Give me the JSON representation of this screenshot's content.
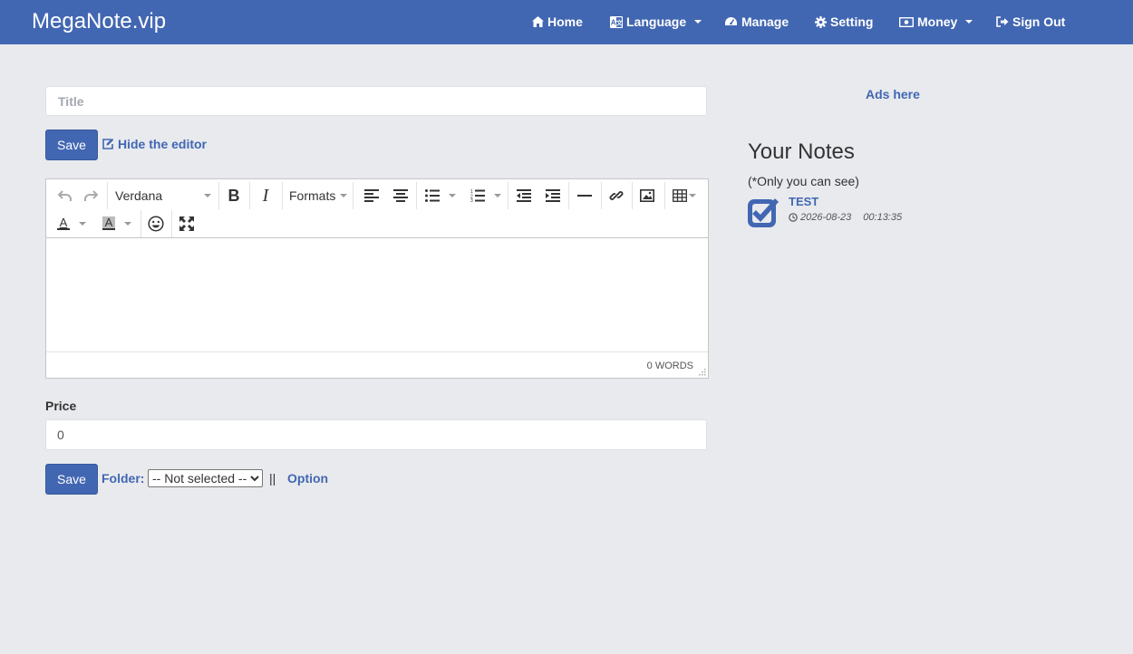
{
  "nav": {
    "brand": "MegaNote.vip",
    "items": [
      {
        "label": "Home",
        "icon": "home-icon"
      },
      {
        "label": "Language",
        "icon": "language-icon",
        "dropdown": true
      },
      {
        "label": "Manage",
        "icon": "dashboard-icon"
      },
      {
        "label": "Setting",
        "icon": "gear-icon"
      },
      {
        "label": "Money",
        "icon": "money-icon",
        "dropdown": true
      },
      {
        "label": "Sign Out",
        "icon": "sign-out-icon"
      }
    ]
  },
  "form": {
    "title_placeholder": "Title",
    "title_value": "",
    "save_label": "Save",
    "hide_editor_label": "Hide the editor",
    "price_label": "Price",
    "price_value": "0",
    "folder_label": "Folder:",
    "folder_selected": "-- Not selected --",
    "separator": "||",
    "option_label": "Option"
  },
  "editor": {
    "font_family": "Verdana",
    "formats_label": "Formats",
    "word_count": "0 WORDS"
  },
  "sidebar": {
    "ads_text": "Ads here",
    "heading": "Your Notes",
    "subtitle": "(*Only you can see)",
    "notes": [
      {
        "title": "TEST",
        "date": "2026-08-23",
        "time": "00:13:35",
        "icon": "checkbox-icon"
      }
    ]
  },
  "colors": {
    "brand": "#4267b2",
    "background": "#e8eaee"
  }
}
